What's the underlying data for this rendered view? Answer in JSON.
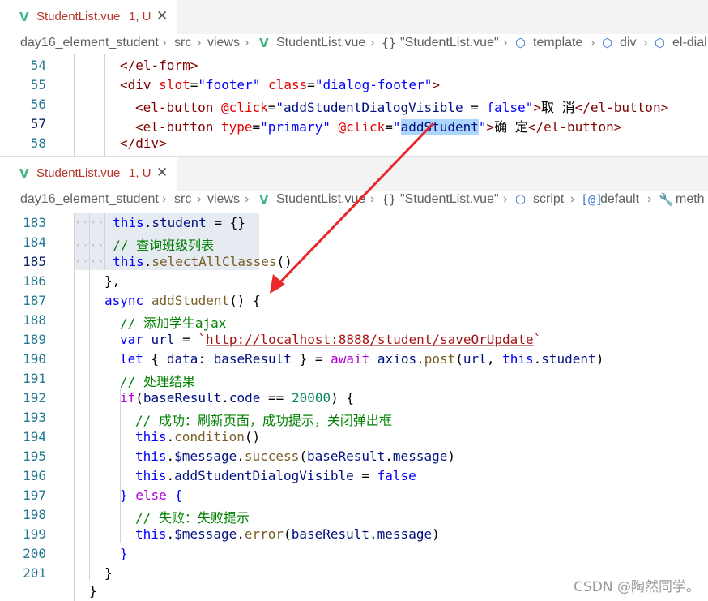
{
  "pane1": {
    "tab": {
      "icon": "vue-file-icon",
      "file": "StudentList.vue",
      "status": "1, U",
      "close": "✕"
    },
    "breadcrumb": [
      "day16_element_student",
      "src",
      "views",
      "StudentList.vue",
      "\"StudentList.vue\"",
      "template",
      "div",
      "el-dial"
    ],
    "lines": [
      {
        "num": "54",
        "code": "</el-form>"
      },
      {
        "num": "55",
        "code": "<div slot=\"footer\" class=\"dialog-footer\">"
      },
      {
        "num": "56",
        "code": "<el-button @click=\"addStudentDialogVisible = false\">取 消</el-button>"
      },
      {
        "num": "57",
        "code": "<el-button type=\"primary\" @click=\"addStudent\">确 定</el-button>",
        "selected": "addStudent"
      },
      {
        "num": "58",
        "code": "</div>"
      }
    ]
  },
  "pane2": {
    "tab": {
      "icon": "vue-file-icon",
      "file": "StudentList.vue",
      "status": "1, U",
      "close": "✕"
    },
    "breadcrumb": [
      "day16_element_student",
      "src",
      "views",
      "StudentList.vue",
      "\"StudentList.vue\"",
      "script",
      "default",
      "meth"
    ],
    "lines": [
      {
        "num": "183",
        "code": "this.student = {}"
      },
      {
        "num": "184",
        "code": "// 查询班级列表"
      },
      {
        "num": "185",
        "code": "this.selectAllClasses()"
      },
      {
        "num": "186",
        "code": "},"
      },
      {
        "num": "187",
        "code": "async addStudent() {"
      },
      {
        "num": "188",
        "code": "// 添加学生ajax"
      },
      {
        "num": "189",
        "code": "var url = `http://localhost:8888/student/saveOrUpdate`"
      },
      {
        "num": "190",
        "code": "let { data: baseResult } = await axios.post(url, this.student)"
      },
      {
        "num": "191",
        "code": "// 处理结果"
      },
      {
        "num": "192",
        "code": "if(baseResult.code == 20000) {"
      },
      {
        "num": "193",
        "code": "// 成功：刷新页面，成功提示，关闭弹出框"
      },
      {
        "num": "194",
        "code": "this.condition()"
      },
      {
        "num": "195",
        "code": "this.$message.success(baseResult.message)"
      },
      {
        "num": "196",
        "code": "this.addStudentDialogVisible = false"
      },
      {
        "num": "197",
        "code": "} else {"
      },
      {
        "num": "198",
        "code": "// 失败：失败提示"
      },
      {
        "num": "199",
        "code": "this.$message.error(baseResult.message)"
      },
      {
        "num": "200",
        "code": "}"
      },
      {
        "num": "201",
        "code": "}"
      }
    ]
  },
  "watermark": "CSDN @陶然同学。",
  "colors": {
    "arrow": "#e8282b",
    "selection": "#add6ff",
    "lineNumber": "#237893",
    "tabText": "#b5372b"
  }
}
